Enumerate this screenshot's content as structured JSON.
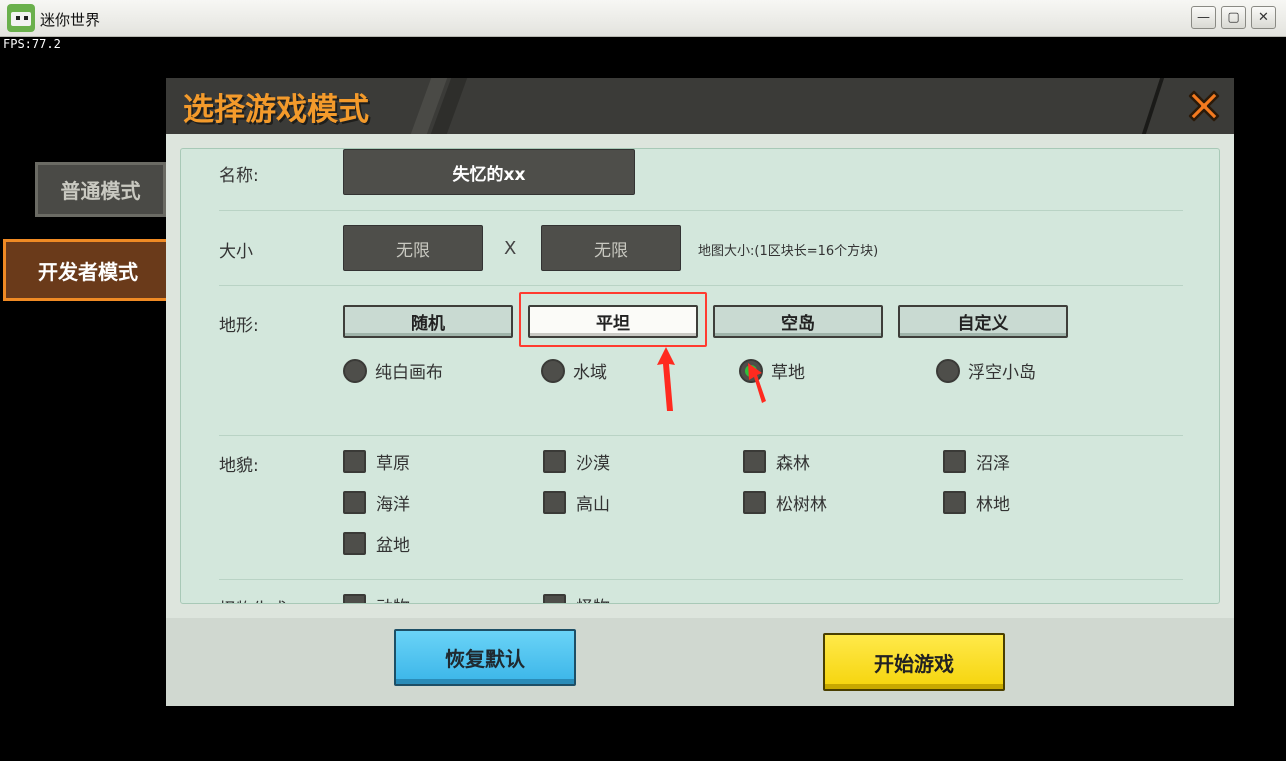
{
  "window": {
    "title": "迷你世界",
    "minimize_glyph": "—",
    "maximize_glyph": "▢",
    "close_glyph": "✕"
  },
  "fps_text": "FPS:77.2",
  "side_tabs": [
    {
      "label": "普通模式",
      "active": false
    },
    {
      "label": "开发者模式",
      "active": true
    }
  ],
  "dialog": {
    "title": "选择游戏模式",
    "close_icon": "close-x-icon",
    "name": {
      "label": "名称:",
      "value": "失忆的xx"
    },
    "size": {
      "label": "大小",
      "width": "无限",
      "separator": "X",
      "height": "无限",
      "note": "地图大小:(1区块长=16个方块)"
    },
    "terrain": {
      "label": "地形:",
      "buttons": [
        "随机",
        "平坦",
        "空岛",
        "自定义"
      ],
      "selected": "平坦",
      "options": [
        {
          "label": "纯白画布",
          "checked": false
        },
        {
          "label": "水域",
          "checked": false
        },
        {
          "label": "草地",
          "checked": true
        },
        {
          "label": "浮空小岛",
          "checked": false
        }
      ]
    },
    "landform": {
      "label": "地貌:",
      "items": [
        "草原",
        "沙漠",
        "森林",
        "沼泽",
        "海洋",
        "高山",
        "松树林",
        "林地",
        "盆地"
      ]
    },
    "monster": {
      "label": "怪物生成",
      "items": [
        "动物",
        "怪物"
      ]
    },
    "footer": {
      "reset_label": "恢复默认",
      "start_label": "开始游戏"
    }
  },
  "colors": {
    "accent_orange": "#f39a2b",
    "highlight_red": "#ff3b30",
    "radio_on": "#2fbf3a",
    "reset_blue": "#3ab5e8",
    "start_yellow": "#f5d40b"
  }
}
